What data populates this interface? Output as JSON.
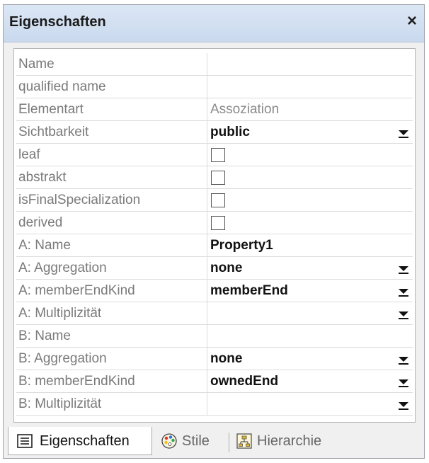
{
  "panel": {
    "title": "Eigenschaften",
    "close_label": "×"
  },
  "rows": [
    {
      "label": "Name",
      "value": "",
      "kind": "text"
    },
    {
      "label": "qualified name",
      "value": "",
      "kind": "text"
    },
    {
      "label": "Elementart",
      "value": "Assoziation",
      "kind": "readonly"
    },
    {
      "label": "Sichtbarkeit",
      "value": "public",
      "kind": "dropdown"
    },
    {
      "label": "leaf",
      "checked": false,
      "kind": "checkbox"
    },
    {
      "label": "abstrakt",
      "checked": false,
      "kind": "checkbox"
    },
    {
      "label": "isFinalSpecialization",
      "checked": false,
      "kind": "checkbox"
    },
    {
      "label": "derived",
      "checked": false,
      "kind": "checkbox"
    },
    {
      "label": "A: Name",
      "value": "Property1",
      "kind": "text"
    },
    {
      "label": "A: Aggregation",
      "value": "none",
      "kind": "dropdown"
    },
    {
      "label": "A: memberEndKind",
      "value": "memberEnd",
      "kind": "dropdown"
    },
    {
      "label": "A: Multiplizität",
      "value": "",
      "kind": "dropdown"
    },
    {
      "label": "B: Name",
      "value": "",
      "kind": "text"
    },
    {
      "label": "B: Aggregation",
      "value": "none",
      "kind": "dropdown"
    },
    {
      "label": "B: memberEndKind",
      "value": "ownedEnd",
      "kind": "dropdown"
    },
    {
      "label": "B: Multiplizität",
      "value": "",
      "kind": "dropdown"
    }
  ],
  "tabs": {
    "eigenschaften": "Eigenschaften",
    "stile": "Stile",
    "hierarchie": "Hierarchie"
  },
  "colors": {
    "title_bar": "#c9d9ee",
    "label_text": "#7a7a7a"
  }
}
